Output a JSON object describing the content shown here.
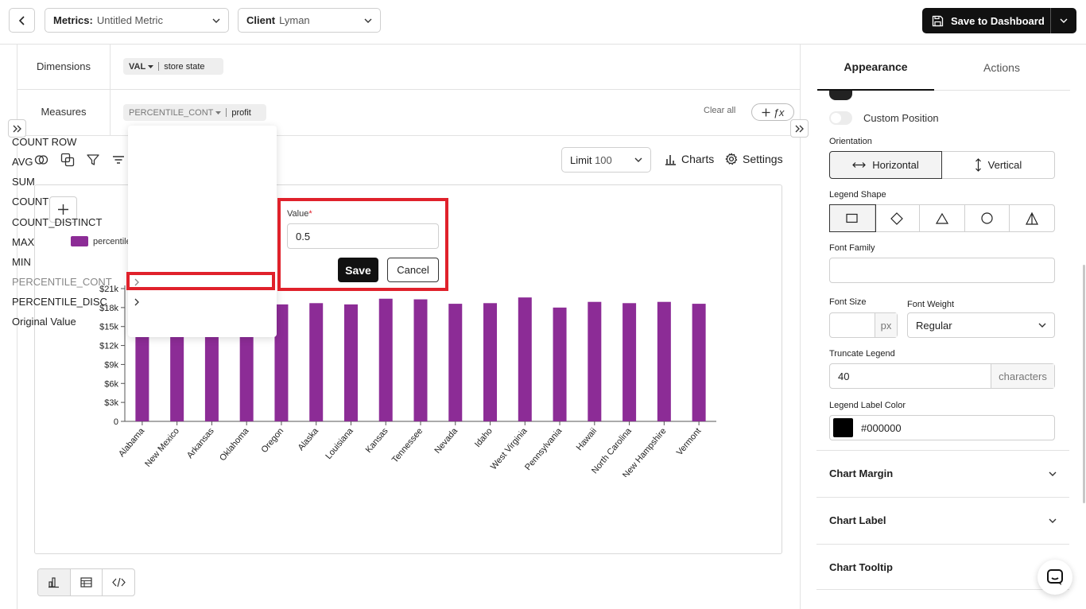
{
  "header": {
    "metrics_label": "Metrics:",
    "metrics_value": "Untitled Metric",
    "client_label": "Client",
    "client_value": "Lyman",
    "save_dashboard": "Save to Dashboard"
  },
  "query": {
    "dimensions_label": "Dimensions",
    "dimension_chip": {
      "agg": "VAL",
      "field": "store state"
    },
    "measures_label": "Measures",
    "measure_chip": {
      "agg": "PERCENTILE_CONT",
      "field": "profit"
    },
    "clear_all": "Clear all",
    "fx_label": "ƒx"
  },
  "toolbar": {
    "limit_label": "Limit",
    "limit_value": "100",
    "charts": "Charts",
    "settings": "Settings"
  },
  "legend": {
    "label": "percentile",
    "color": "#8c2c96"
  },
  "agg_menu": {
    "items": [
      "COUNT ROW",
      "AVG",
      "SUM",
      "COUNT",
      "COUNT_DISTINCT",
      "MAX",
      "MIN",
      "PERCENTILE_CONT",
      "PERCENTILE_DISC",
      "Original Value"
    ]
  },
  "value_popup": {
    "label": "Value",
    "required_mark": "*",
    "value": "0.5",
    "save": "Save",
    "cancel": "Cancel"
  },
  "chart_data": {
    "type": "bar",
    "categories": [
      "Alabama",
      "New Mexico",
      "Arkansas",
      "Oklahoma",
      "Oregon",
      "Alaska",
      "Louisiana",
      "Kansas",
      "Tennessee",
      "Nevada",
      "Idaho",
      "West Virginia",
      "Pennsylvania",
      "Hawaii",
      "North Carolina",
      "New Hampshire",
      "Vermont"
    ],
    "series": [
      {
        "values": [
          18300,
          18400,
          18500,
          18500,
          18500,
          18700,
          18500,
          19400,
          19300,
          18600,
          18700,
          19600,
          18000,
          18900,
          18700,
          18900,
          18600
        ]
      }
    ],
    "y_ticks": [
      "0",
      "$3k",
      "$6k",
      "$9k",
      "$12k",
      "$15k",
      "$18k",
      "$21k"
    ],
    "ylim": [
      0,
      21000
    ],
    "bar_color": "#8c2c96"
  },
  "right_panel": {
    "tabs": [
      "Appearance",
      "Actions"
    ],
    "custom_position": "Custom Position",
    "orientation_label": "Orientation",
    "orientation_options": [
      "Horizontal",
      "Vertical"
    ],
    "legend_shape_label": "Legend Shape",
    "font_family_label": "Font Family",
    "font_family_value": "",
    "font_size_label": "Font Size",
    "font_size_unit": "px",
    "font_weight_label": "Font Weight",
    "font_weight_value": "Regular",
    "truncate_label": "Truncate Legend",
    "truncate_value": "40",
    "truncate_unit": "characters",
    "label_color_label": "Legend Label Color",
    "label_color_value": "#000000",
    "sections": [
      "Chart Margin",
      "Chart Label",
      "Chart Tooltip"
    ]
  }
}
